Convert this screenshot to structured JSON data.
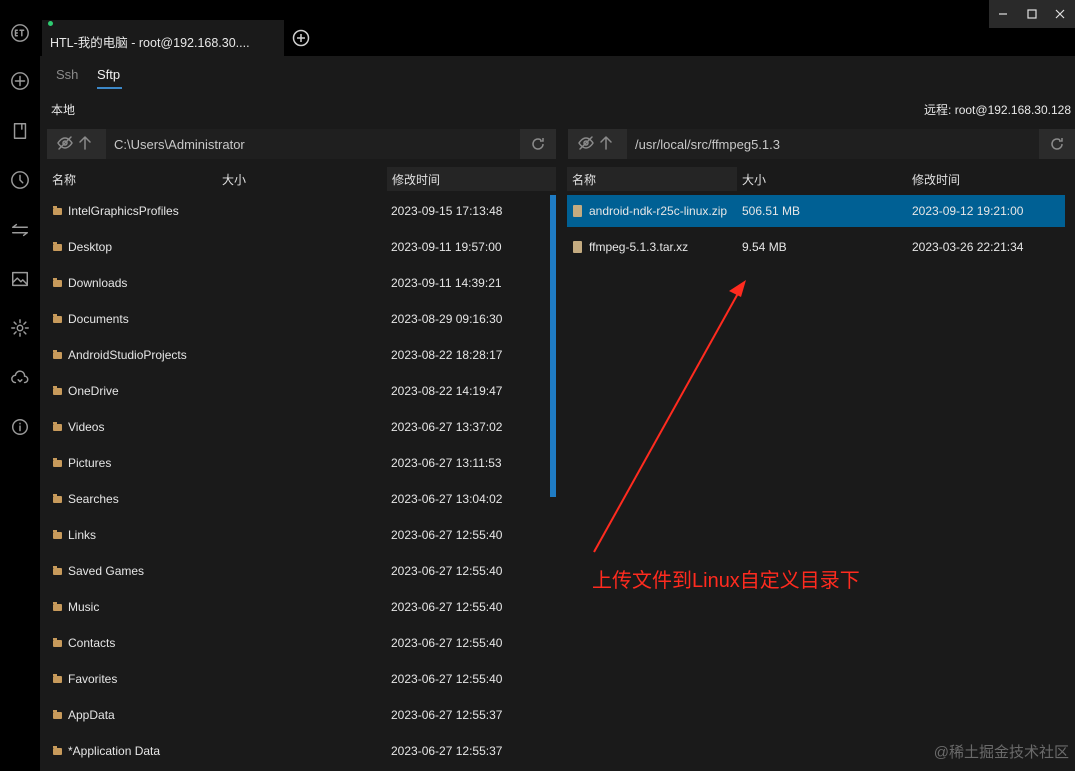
{
  "window": {
    "tab_title": "HTL-我的电脑 - root@192.168.30....",
    "status_dot_color": "#2ecc71"
  },
  "sidebar": {
    "icons": [
      "app-logo-icon",
      "add-circle-icon",
      "bookmark-icon",
      "history-clock-icon",
      "transfer-icon",
      "image-icon",
      "gear-icon",
      "cloud-sync-icon",
      "info-icon"
    ]
  },
  "subtabs": {
    "ssh": "Ssh",
    "sftp": "Sftp"
  },
  "local": {
    "label": "本地",
    "path": "C:\\Users\\Administrator",
    "columns": {
      "name": "名称",
      "size": "大小",
      "modified": "修改时间"
    },
    "rows": [
      {
        "name": "IntelGraphicsProfiles",
        "size": "",
        "modified": "2023-09-15 17:13:48"
      },
      {
        "name": "Desktop",
        "size": "",
        "modified": "2023-09-11 19:57:00"
      },
      {
        "name": "Downloads",
        "size": "",
        "modified": "2023-09-11 14:39:21"
      },
      {
        "name": "Documents",
        "size": "",
        "modified": "2023-08-29 09:16:30"
      },
      {
        "name": "AndroidStudioProjects",
        "size": "",
        "modified": "2023-08-22 18:28:17"
      },
      {
        "name": "OneDrive",
        "size": "",
        "modified": "2023-08-22 14:19:47"
      },
      {
        "name": "Videos",
        "size": "",
        "modified": "2023-06-27 13:37:02"
      },
      {
        "name": "Pictures",
        "size": "",
        "modified": "2023-06-27 13:11:53"
      },
      {
        "name": "Searches",
        "size": "",
        "modified": "2023-06-27 13:04:02"
      },
      {
        "name": "Links",
        "size": "",
        "modified": "2023-06-27 12:55:40"
      },
      {
        "name": "Saved Games",
        "size": "",
        "modified": "2023-06-27 12:55:40"
      },
      {
        "name": "Music",
        "size": "",
        "modified": "2023-06-27 12:55:40"
      },
      {
        "name": "Contacts",
        "size": "",
        "modified": "2023-06-27 12:55:40"
      },
      {
        "name": "Favorites",
        "size": "",
        "modified": "2023-06-27 12:55:40"
      },
      {
        "name": "AppData",
        "size": "",
        "modified": "2023-06-27 12:55:37"
      },
      {
        "name": "*Application Data",
        "size": "",
        "modified": "2023-06-27 12:55:37"
      }
    ]
  },
  "remote": {
    "label": "远程: root@192.168.30.128",
    "path": "/usr/local/src/ffmpeg5.1.3",
    "columns": {
      "name": "名称",
      "size": "大小",
      "modified": "修改时间"
    },
    "rows": [
      {
        "name": "android-ndk-r25c-linux.zip",
        "size": "506.51 MB",
        "modified": "2023-09-12 19:21:00",
        "selected": true
      },
      {
        "name": "ffmpeg-5.1.3.tar.xz",
        "size": "9.54 MB",
        "modified": "2023-03-26 22:21:34",
        "selected": false
      }
    ]
  },
  "annotation": {
    "text": "上传文件到Linux自定义目录下",
    "color": "#ff2b1f"
  },
  "watermark": "@稀土掘金技术社区",
  "colors": {
    "selection": "#006094",
    "scrollbar": "#1f7cc4",
    "folder": "#c79a5b"
  }
}
